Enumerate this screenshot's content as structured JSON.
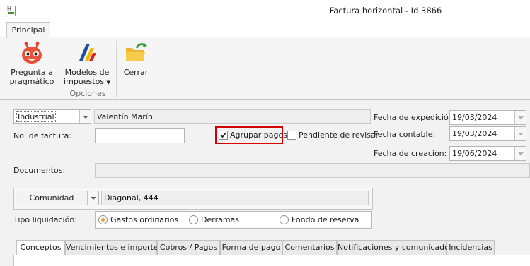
{
  "window": {
    "title": "Factura horizontal - Id 3866"
  },
  "ribbon": {
    "tab": "Principal",
    "buttons": {
      "pregunta_line1": "Pregunta a",
      "pregunta_line2": "pragmático",
      "modelos_line1": "Modelos de",
      "modelos_line2": "impuestos",
      "cerrar": "Cerrar"
    },
    "group_label": "Opciones"
  },
  "form": {
    "tipo_select": "Industrial",
    "nombre": "Valentín Marín",
    "no_factura_label": "No. de factura:",
    "no_factura_value": "",
    "agrupar_pagos_label": "Agrupar pagos",
    "agrupar_pagos_checked": true,
    "pendiente_label": "Pendiente de revisar",
    "pendiente_checked": false,
    "fecha_expedicion_label": "Fecha de expedición:",
    "fecha_expedicion": "19/03/2024",
    "fecha_contable_label": "Fecha contable:",
    "fecha_contable": "19/03/2024",
    "fecha_creacion_label": "Fecha de creación:",
    "fecha_creacion": "19/06/2024",
    "documentos_label": "Documentos:",
    "documentos_value": "",
    "comunidad_select": "Comunidad",
    "comunidad_value": "Diagonal, 444",
    "tipo_liquidacion_label": "Tipo liquidación:",
    "tipo_liquidacion_options": [
      "Gastos ordinarios",
      "Derramas",
      "Fondo de reserva"
    ],
    "tipo_liquidacion_selected": "Gastos ordinarios"
  },
  "tabs": [
    "Conceptos",
    "Vencimientos e importes",
    "Cobros / Pagos",
    "Forma de pago",
    "Comentarios",
    "Notificaciones y comunicados",
    "Incidencias"
  ],
  "active_tab": "Conceptos",
  "colors": {
    "highlight": "#d40000",
    "radio_selected": "#e6a12b"
  }
}
